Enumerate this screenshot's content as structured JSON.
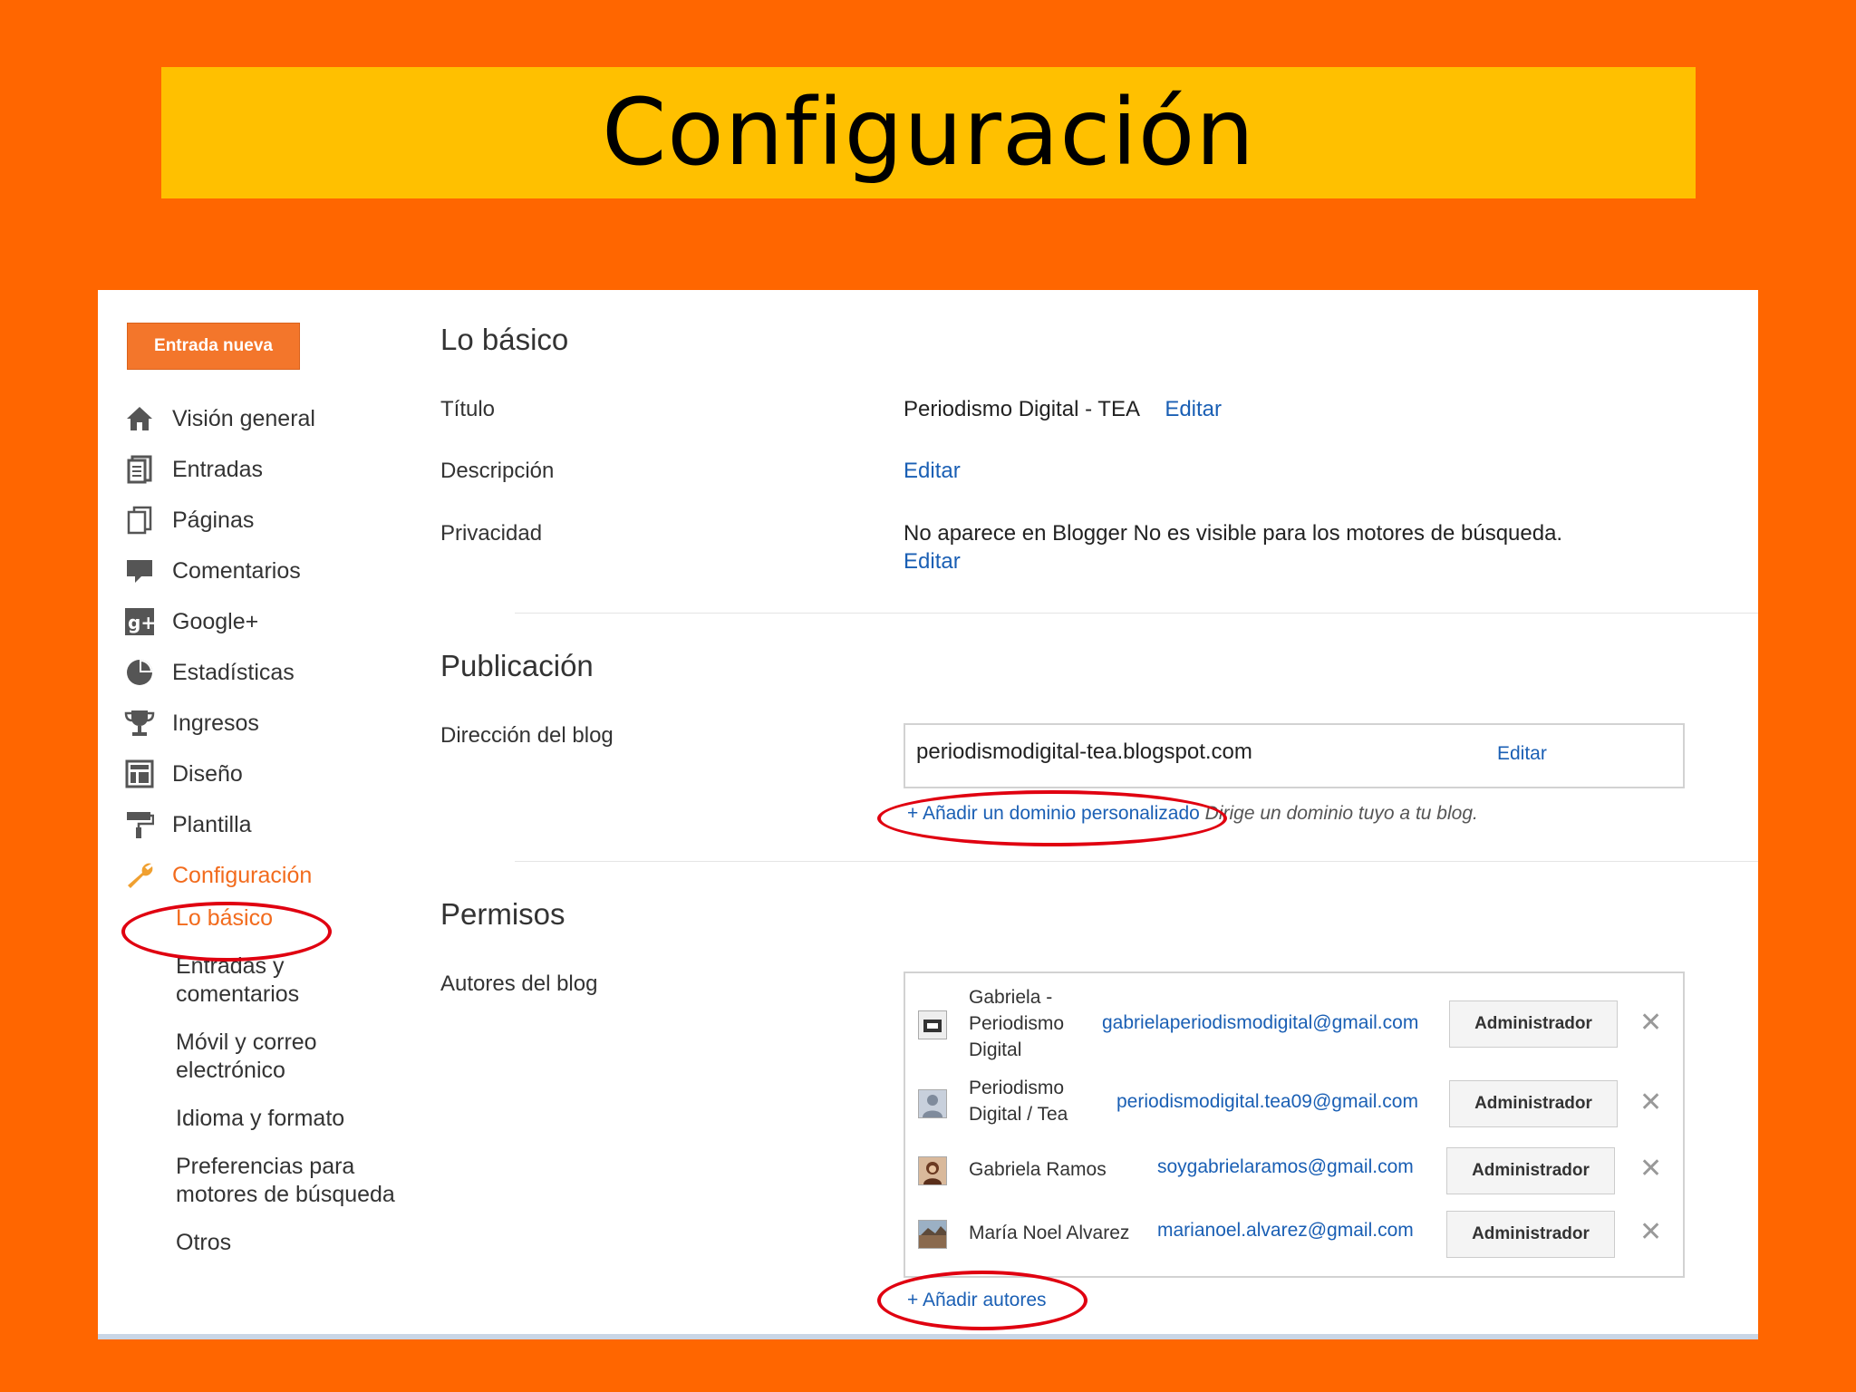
{
  "slide": {
    "title": "Configuración"
  },
  "sidebar": {
    "new_post_label": "Entrada nueva",
    "items": [
      {
        "label": "Visión general",
        "icon": "home-icon"
      },
      {
        "label": "Entradas",
        "icon": "posts-icon"
      },
      {
        "label": "Páginas",
        "icon": "pages-icon"
      },
      {
        "label": "Comentarios",
        "icon": "comments-icon"
      },
      {
        "label": "Google+",
        "icon": "google-plus-icon"
      },
      {
        "label": "Estadísticas",
        "icon": "stats-icon"
      },
      {
        "label": "Ingresos",
        "icon": "trophy-icon"
      },
      {
        "label": "Diseño",
        "icon": "layout-icon"
      },
      {
        "label": "Plantilla",
        "icon": "paint-roller-icon"
      },
      {
        "label": "Configuración",
        "icon": "wrench-icon"
      }
    ],
    "sub_items": [
      {
        "label": "Lo básico"
      },
      {
        "label": "Entradas y comentarios"
      },
      {
        "label": "Móvil y correo electrónico"
      },
      {
        "label": "Idioma y formato"
      },
      {
        "label": "Preferencias para motores de búsqueda"
      },
      {
        "label": "Otros"
      }
    ]
  },
  "basics": {
    "section_title": "Lo básico",
    "title_label": "Título",
    "title_value": "Periodismo Digital - TEA",
    "title_edit": "Editar",
    "description_label": "Descripción",
    "description_edit": "Editar",
    "privacy_label": "Privacidad",
    "privacy_value": "No aparece en Blogger No es visible para los motores de búsqueda.",
    "privacy_edit": "Editar"
  },
  "publishing": {
    "section_title": "Publicación",
    "address_label": "Dirección del blog",
    "address_value": "periodismodigital-tea.blogspot.com",
    "address_edit": "Editar",
    "custom_domain_link": "+ Añadir un dominio personalizado",
    "custom_domain_hint": "Dirige un dominio tuyo a tu blog."
  },
  "permissions": {
    "section_title": "Permisos",
    "authors_label": "Autores del blog",
    "authors": [
      {
        "name": "Gabriela - Periodismo Digital",
        "email": "gabrielaperiodismodigital@gmail.com",
        "role": "Administrador"
      },
      {
        "name": "Periodismo Digital / Tea",
        "email": "periodismodigital.tea09@gmail.com",
        "role": "Administrador"
      },
      {
        "name": "Gabriela Ramos",
        "email": "soygabrielaramos@gmail.com",
        "role": "Administrador"
      },
      {
        "name": "María Noel Alvarez",
        "email": "marianoel.alvarez@gmail.com",
        "role": "Administrador"
      }
    ],
    "remove_glyph": "✕",
    "add_authors_link": "+ Añadir autores"
  },
  "colors": {
    "slide_bg": "#FF6600",
    "banner": "#FFC000",
    "accent": "#F26B1D",
    "link": "#1A5FB4",
    "annotation": "#E00010"
  }
}
